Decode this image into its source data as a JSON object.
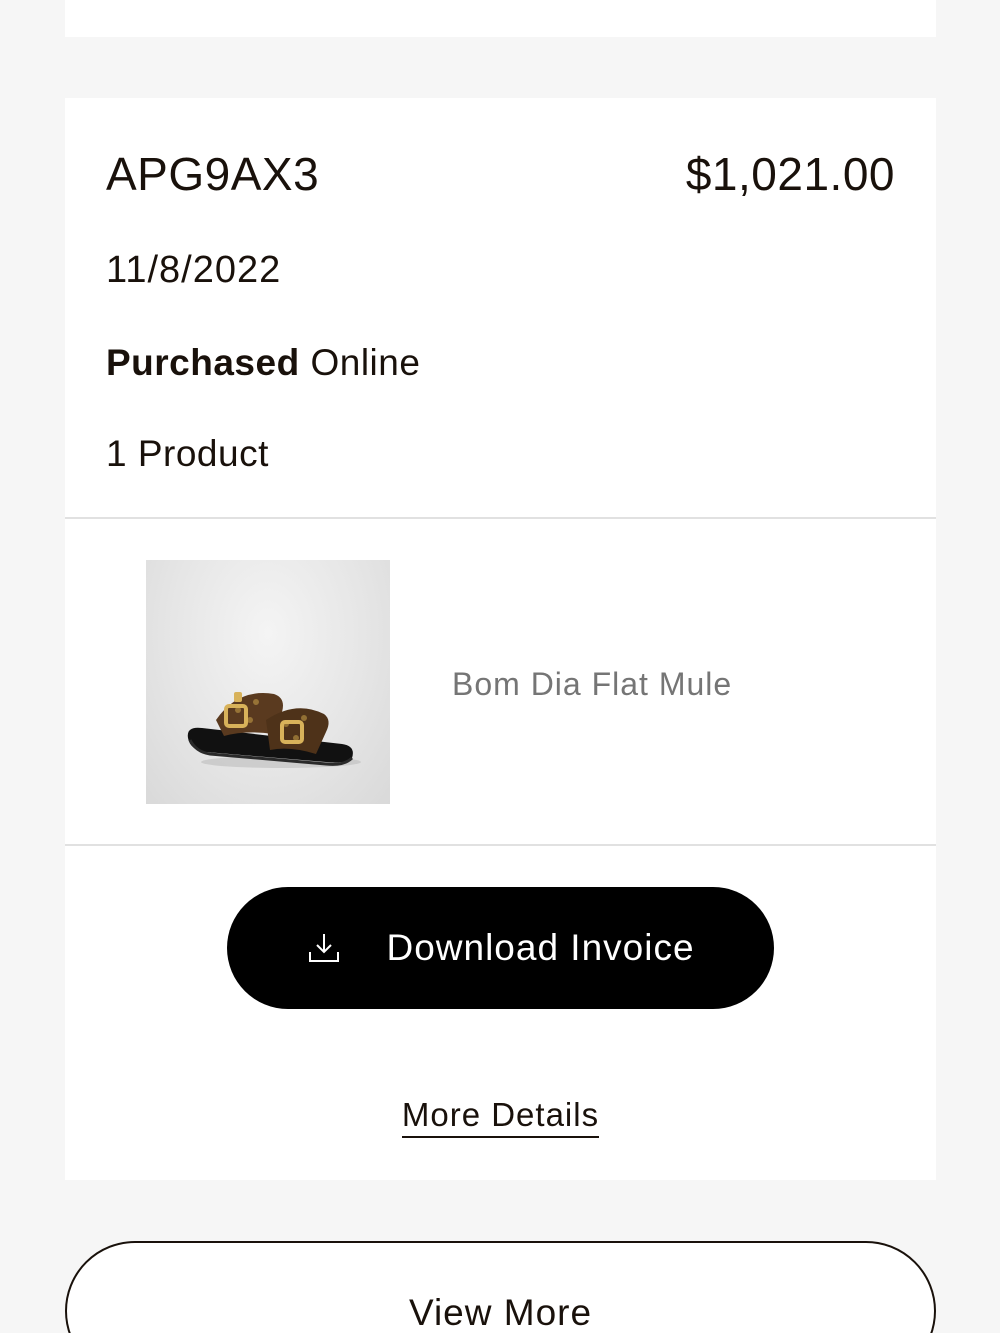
{
  "order": {
    "id": "APG9AX3",
    "total": "$1,021.00",
    "date": "11/8/2022",
    "purchase_label": "Purchased",
    "purchase_channel": "Online",
    "product_count": "1 Product"
  },
  "product": {
    "name": "Bom Dia Flat Mule",
    "image_alt": "Bom Dia Flat Mule sandal with brown monogram straps and gold buckles"
  },
  "actions": {
    "download_invoice": "Download Invoice",
    "download_icon": "download-icon",
    "more_details": "More Details",
    "view_more": "View More"
  }
}
